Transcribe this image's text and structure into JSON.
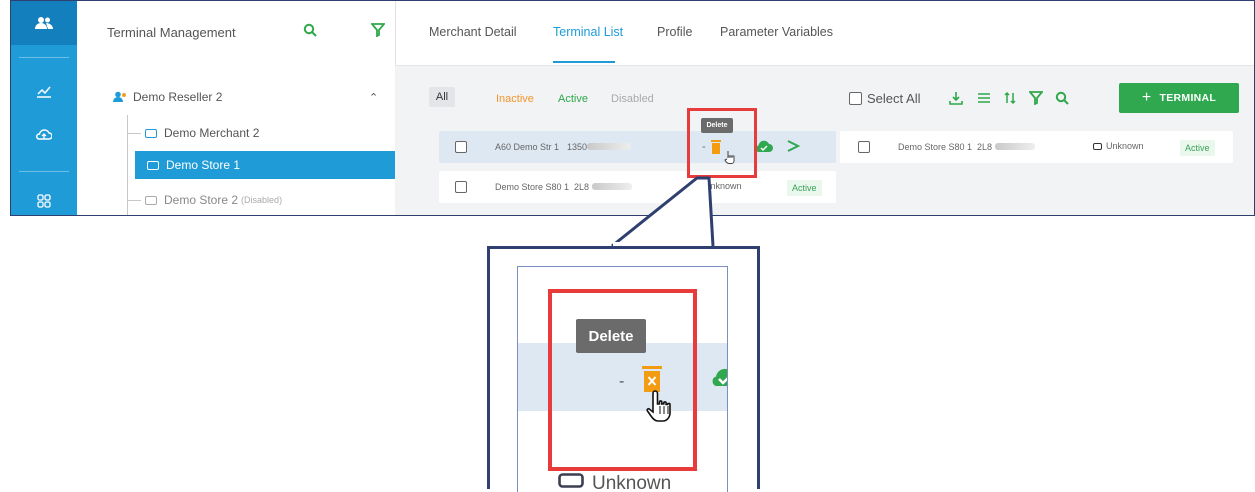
{
  "sidebar": {
    "title": "Terminal Management",
    "tree": [
      {
        "label": "Demo Reseller 2",
        "suffix": ""
      },
      {
        "label": "Demo Merchant 2",
        "suffix": ""
      },
      {
        "label": "Demo Store 1",
        "suffix": ""
      },
      {
        "label": "Demo Store 2",
        "suffix": "(Disabled)"
      }
    ]
  },
  "tabs": [
    "Merchant Detail",
    "Terminal List",
    "Profile",
    "Parameter Variables"
  ],
  "filters": [
    "All",
    "Inactive",
    "Active",
    "Disabled"
  ],
  "toolbar": {
    "select_all": "Select All",
    "add_button": "TERMINAL"
  },
  "terminals": [
    {
      "name": "A60 Demo Str 1",
      "serial": "1350",
      "dash": "-"
    },
    {
      "name": "Demo Store S80 1",
      "serial": "2L8",
      "status": "Unknown",
      "badge": "Active"
    }
  ],
  "right_terminal": {
    "name": "Demo Store S80 1",
    "serial": "2L8",
    "status": "Unknown",
    "badge": "Active"
  },
  "tooltip": "Delete",
  "zoom": {
    "tooltip": "Delete",
    "dash": "-",
    "status": "Unknown"
  },
  "colors": {
    "accent": "#1f9bd7",
    "green": "#2fa84f",
    "highlight": "#e83b3b",
    "callout": "#2f3f6f",
    "delete_icon": "#f39c12"
  }
}
